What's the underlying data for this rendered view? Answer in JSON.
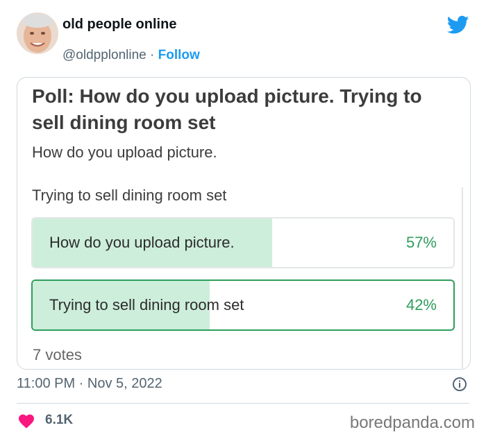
{
  "author": {
    "display_name": "old people online",
    "handle": "@oldpplonline",
    "separator": " · ",
    "follow_label": "Follow"
  },
  "icons": {
    "brand": "twitter-bird-icon",
    "info": "info-icon",
    "like": "heart-icon"
  },
  "colors": {
    "link_blue": "#1d9bf0",
    "poll_green": "#2e9d5b",
    "poll_fill": "#cdeedb",
    "like_red": "#f91880"
  },
  "poll": {
    "title": "Poll: How do you upload picture. Trying to sell dining room set",
    "description_line1": "How do you upload picture.",
    "description_line2": "Trying to sell dining room set",
    "options": [
      {
        "label": "How do you upload picture.",
        "percent": "57%",
        "share": 0.57,
        "selected": false
      },
      {
        "label": "Trying to sell dining room set",
        "percent": "42%",
        "share": 0.42,
        "selected": true
      }
    ],
    "votes": "7 votes"
  },
  "meta": {
    "timestamp": "11:00 PM · Nov 5, 2022",
    "likes": "6.1K"
  },
  "watermark": "boredpanda.com"
}
